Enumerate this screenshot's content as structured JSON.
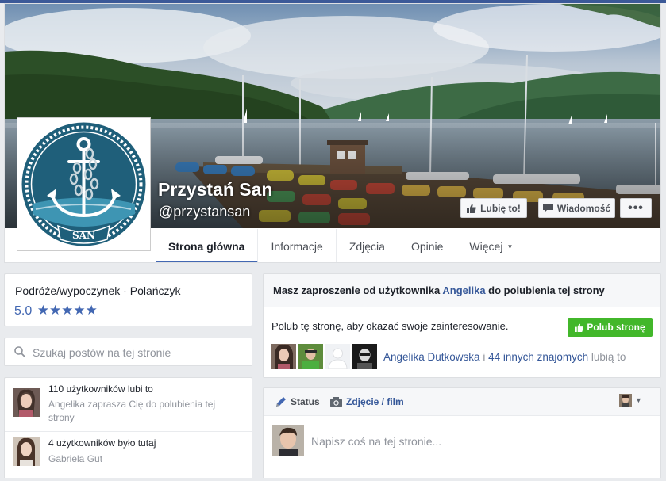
{
  "page": {
    "title": "Przystań San",
    "handle": "@przystansan",
    "logo_text": "SAN"
  },
  "cover_actions": {
    "like_label": "Lubię to!",
    "message_label": "Wiadomość",
    "more_label": "•••"
  },
  "nav": {
    "tabs": [
      {
        "label": "Strona główna"
      },
      {
        "label": "Informacje"
      },
      {
        "label": "Zdjęcia"
      },
      {
        "label": "Opinie"
      },
      {
        "label": "Więcej"
      }
    ]
  },
  "info": {
    "category": "Podróże/wypoczynek · Polańczyk",
    "rating": "5.0",
    "stars": "★★★★★"
  },
  "search": {
    "placeholder": "Szukaj postów na tej stronie"
  },
  "activity": [
    {
      "title": "110 użytkowników lubi to",
      "sub": "Angelika zaprasza Cię do polubienia tej strony"
    },
    {
      "title": "4 użytkowników było tutaj",
      "sub": "Gabriela Gut"
    }
  ],
  "invite": {
    "title_prefix": "Masz zaproszenie od użytkownika ",
    "inviter": "Angelika",
    "title_suffix": " do polubienia tej strony",
    "prompt": "Polub tę stronę, aby okazać swoje zainteresowanie.",
    "button_label": "Polub stronę",
    "friends_name": "Angelika Dutkowska",
    "friends_and": " i ",
    "friends_others": "44 innych znajomych",
    "friends_suffix": " lubią to"
  },
  "composer": {
    "status_tab": "Status",
    "photo_tab": "Zdjęcie / film",
    "placeholder": "Napisz coś na tej stronie..."
  },
  "colors": {
    "brand_blue": "#4267b2",
    "link_blue": "#365899",
    "like_green": "#42b72a",
    "logo_teal": "#1f5f7a"
  }
}
